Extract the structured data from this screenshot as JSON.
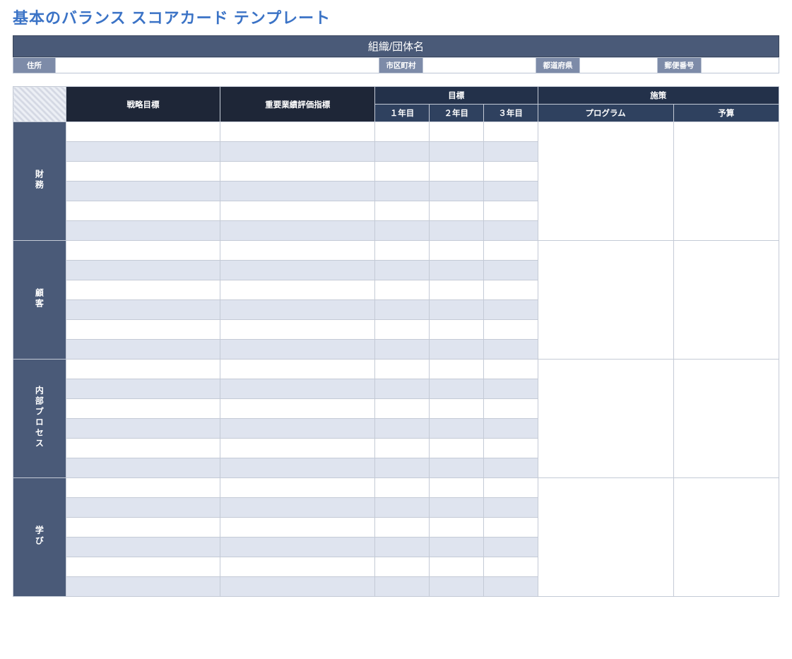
{
  "title": "基本のバランス スコアカード テンプレート",
  "header": {
    "org_name_label": "組織/団体名",
    "address_label": "住所",
    "city_label": "市区町村",
    "prefecture_label": "都道府県",
    "postal_label": "郵便番号",
    "address_value": "",
    "city_value": "",
    "prefecture_value": "",
    "postal_value": ""
  },
  "columns": {
    "strategic_goal": "戦略目標",
    "kpi": "重要業績評価指標",
    "targets_group": "目標",
    "year1": "１年目",
    "year2": "２年目",
    "year3": "３年目",
    "initiatives_group": "施策",
    "program": "プログラム",
    "budget": "予算"
  },
  "perspectives": [
    {
      "label": "財務"
    },
    {
      "label": "顧客"
    },
    {
      "label": "内部プロセス"
    },
    {
      "label": "学び"
    }
  ],
  "rows_per_perspective": 6
}
